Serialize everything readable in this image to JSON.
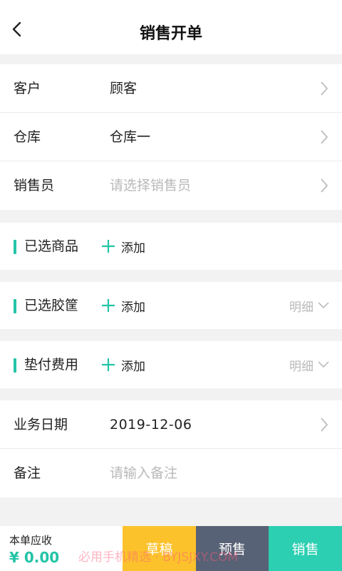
{
  "header": {
    "title": "销售开单",
    "back_icon": "back-chevron-icon"
  },
  "basic_info": [
    {
      "label": "客户",
      "value": "顾客",
      "placeholder": false
    },
    {
      "label": "仓库",
      "value": "仓库一",
      "placeholder": false
    },
    {
      "label": "销售员",
      "value": "请选择销售员",
      "placeholder": true
    }
  ],
  "groups": {
    "goods": {
      "label": "已选商品",
      "add_label": "添加"
    },
    "baskets": {
      "label": "已选胶筐",
      "add_label": "添加",
      "detail_label": "明细"
    },
    "advance": {
      "label": "垫付费用",
      "add_label": "添加",
      "detail_label": "明细"
    }
  },
  "extra_info": {
    "date": {
      "label": "业务日期",
      "value": "2019-12-06"
    },
    "remark": {
      "label": "备注",
      "placeholder": "请输入备注"
    }
  },
  "footer": {
    "total_label": "本单应收",
    "total_amount": "¥ 0.00",
    "draft_label": "草稿",
    "presale_label": "预售",
    "sell_label": "销售"
  },
  "watermark": "必用手机精选 · BYJSJXY.COM",
  "colors": {
    "accent": "#23c4a6",
    "draft": "#fcc22c",
    "presale": "#586276",
    "sell": "#2ccfb1"
  }
}
